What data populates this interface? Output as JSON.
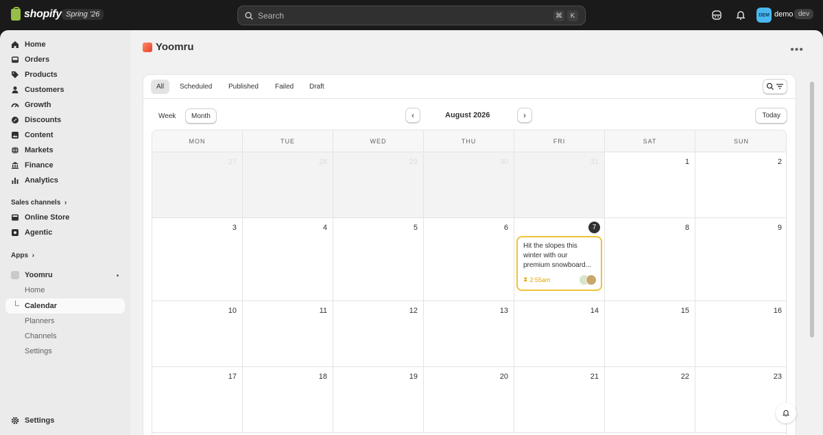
{
  "topbar": {
    "brand": "shopify",
    "season_badge": "Spring '26",
    "search_placeholder": "Search",
    "shortcut_keys": [
      "⌘",
      "K"
    ],
    "avatar_initials": "DEM",
    "user_name": "demo",
    "env_badge": "dev"
  },
  "sidebar": {
    "items": [
      {
        "label": "Home",
        "icon": "home-icon"
      },
      {
        "label": "Orders",
        "icon": "inbox-icon"
      },
      {
        "label": "Products",
        "icon": "tag-icon"
      },
      {
        "label": "Customers",
        "icon": "person-icon"
      },
      {
        "label": "Growth",
        "icon": "gauge-icon"
      },
      {
        "label": "Discounts",
        "icon": "discount-icon"
      },
      {
        "label": "Content",
        "icon": "content-icon"
      },
      {
        "label": "Markets",
        "icon": "globe-icon"
      },
      {
        "label": "Finance",
        "icon": "bank-icon"
      },
      {
        "label": "Analytics",
        "icon": "bar-chart-icon"
      }
    ],
    "sales_channels_label": "Sales channels",
    "channels": [
      {
        "label": "Online Store",
        "icon": "store-icon"
      },
      {
        "label": "Agentic",
        "icon": "agentic-icon"
      }
    ],
    "apps_label": "Apps",
    "app_name": "Yoomru",
    "app_subitems": [
      "Home",
      "Calendar",
      "Planners",
      "Channels",
      "Settings"
    ],
    "settings_label": "Settings"
  },
  "page": {
    "title": "Yoomru",
    "tabs": [
      "All",
      "Scheduled",
      "Published",
      "Failed",
      "Draft"
    ],
    "active_tab": "All",
    "views": [
      "Week",
      "Month"
    ],
    "active_view": "Month",
    "month_label": "August 2026",
    "today_label": "Today"
  },
  "calendar": {
    "weekdays": [
      "MON",
      "TUE",
      "WED",
      "THU",
      "FRI",
      "SAT",
      "SUN"
    ],
    "weeks": [
      [
        "27",
        "28",
        "29",
        "30",
        "31",
        "1",
        "2"
      ],
      [
        "3",
        "4",
        "5",
        "6",
        "7",
        "8",
        "9"
      ],
      [
        "10",
        "11",
        "12",
        "13",
        "14",
        "15",
        "16"
      ],
      [
        "17",
        "18",
        "19",
        "20",
        "21",
        "22",
        "23"
      ]
    ],
    "event": {
      "text": "Hit the slopes this winter with our premium snowboard...",
      "time": "2:55am"
    }
  },
  "colors": {
    "topbar_bg": "#1a1a1a",
    "accent_event": "#f0c233",
    "avatar_bg": "#49b8f0"
  }
}
